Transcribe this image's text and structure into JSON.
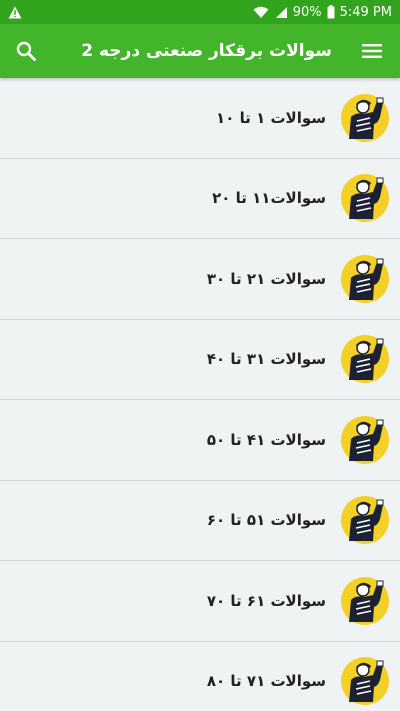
{
  "status_bar": {
    "battery": "90%",
    "time": "5:49 PM",
    "icons": [
      "warning-icon",
      "wifi-icon",
      "signal-icon",
      "battery-icon"
    ]
  },
  "app_bar": {
    "title": "سوالات برقکار صنعتی درجه 2",
    "icons": [
      "menu-icon",
      "search-icon"
    ]
  },
  "list": {
    "items": [
      {
        "label": "سوالات ۱ تا ۱۰"
      },
      {
        "label": "سوالات۱۱ تا ۲۰"
      },
      {
        "label": "سوالات ۲۱ تا ۳۰"
      },
      {
        "label": "سوالات ۳۱ تا ۴۰"
      },
      {
        "label": "سوالات ۴۱ تا ۵۰"
      },
      {
        "label": "سوالات ۵۱ تا ۶۰"
      },
      {
        "label": "سوالات ۶۱ تا ۷۰"
      },
      {
        "label": "سوالات ۷۱ تا ۸۰"
      }
    ]
  },
  "colors": {
    "status_bar": "#31a31c",
    "app_bar": "#43b52a",
    "background": "#f0f3f4",
    "avatar_accent": "#f2d026"
  }
}
